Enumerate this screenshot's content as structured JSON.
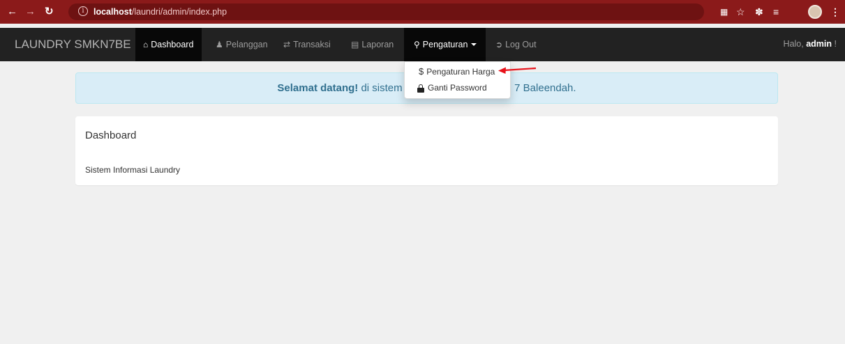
{
  "browser": {
    "url_host": "localhost",
    "url_path": "/laundri/admin/index.php",
    "back_icon": "arrow-left-icon",
    "forward_icon": "arrow-right-icon",
    "reload_icon": "reload-icon",
    "info_icon": "info-icon"
  },
  "navbar": {
    "brand": "LAUNDRY SMKN7BE",
    "items": [
      {
        "label": "Dashboard",
        "icon": "home-icon"
      },
      {
        "label": "Pelanggan",
        "icon": "user-icon"
      },
      {
        "label": "Transaksi",
        "icon": "random-icon"
      },
      {
        "label": "Laporan",
        "icon": "list-alt-icon"
      },
      {
        "label": "Pengaturan",
        "icon": "wrench-icon"
      },
      {
        "label": "Log Out",
        "icon": "log-out-icon"
      }
    ],
    "greeting": "Halo,",
    "username": "admin",
    "greeting_suffix": "!"
  },
  "dropdown": {
    "items": [
      {
        "label": "Pengaturan Harga",
        "icon": "dollar-icon"
      },
      {
        "label": "Ganti Password",
        "icon": "lock-icon"
      }
    ]
  },
  "alert": {
    "strong": "Selamat datang!",
    "text_before_menu": "di sistem i",
    "text_after_menu": "N 7 Baleendah."
  },
  "panel": {
    "title": "Dashboard",
    "body": "Sistem Informasi Laundry"
  },
  "colors": {
    "browser_bar": "#8b1a1a",
    "navbar": "#222222",
    "alert_bg": "#d9edf7",
    "alert_text": "#31708f",
    "annotation": "#e8121a"
  }
}
